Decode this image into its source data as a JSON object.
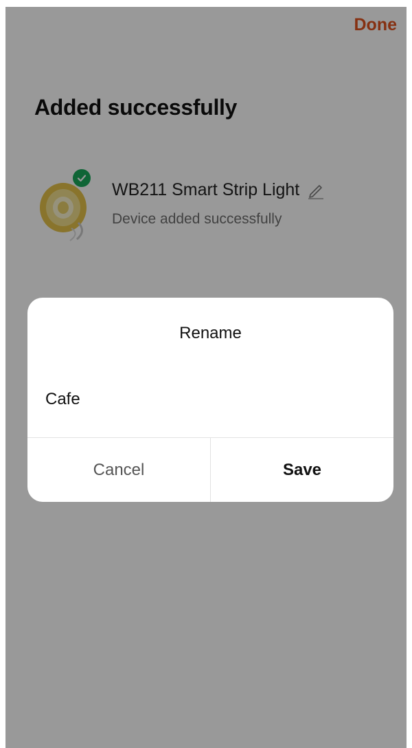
{
  "header": {
    "done_label": "Done"
  },
  "page": {
    "title": "Added successfully"
  },
  "device": {
    "name": "WB211 Smart Strip Light",
    "status": "Device added successfully",
    "icon": "led-strip-reel-image",
    "badge_icon": "check-icon",
    "edit_icon": "pencil-icon"
  },
  "dialog": {
    "title": "Rename",
    "input_value": "Cafe",
    "cancel_label": "Cancel",
    "save_label": "Save"
  },
  "colors": {
    "accent": "#e0531f",
    "success": "#1aa85b",
    "overlay": "rgba(0,0,0,0.40)"
  }
}
